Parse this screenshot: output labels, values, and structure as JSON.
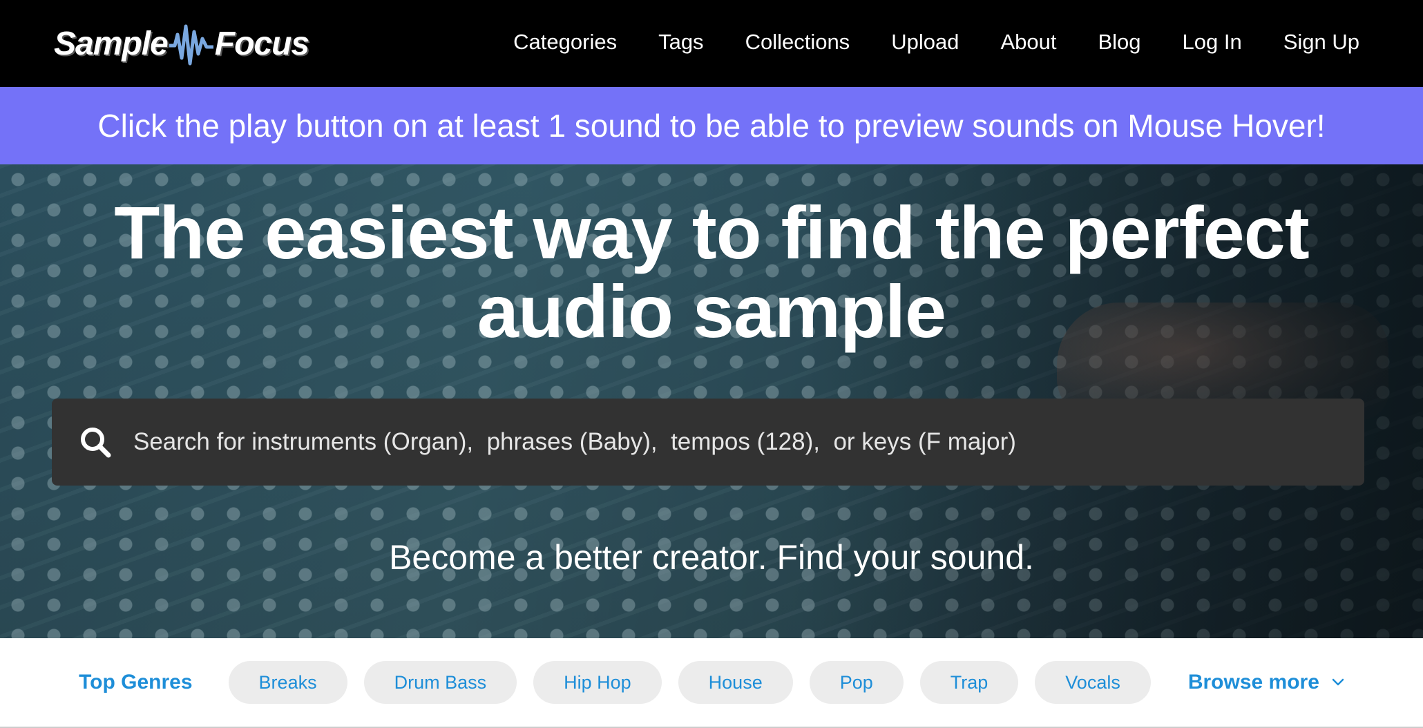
{
  "brand": {
    "logo_left": "Sample",
    "logo_right": "Focus",
    "logo_wave_color": "#7aa8e0"
  },
  "nav": {
    "items": [
      {
        "label": "Categories"
      },
      {
        "label": "Tags"
      },
      {
        "label": "Collections"
      },
      {
        "label": "Upload"
      },
      {
        "label": "About"
      },
      {
        "label": "Blog"
      },
      {
        "label": "Log In"
      },
      {
        "label": "Sign Up"
      }
    ]
  },
  "banner": {
    "text": "Click the play button on at least 1 sound to be able to preview sounds on Mouse Hover!",
    "color": "#7472f8"
  },
  "hero": {
    "headline_line1": "The easiest way to find the perfect",
    "headline_line2": "audio sample",
    "search_placeholder": "Search for instruments (Organ),  phrases (Baby),  tempos (128),  or keys (F major)",
    "search_icon": "search-icon",
    "tagline": "Become a better creator. Find your sound."
  },
  "genres": {
    "label": "Top Genres",
    "chips": [
      {
        "label": "Breaks"
      },
      {
        "label": "Drum Bass"
      },
      {
        "label": "Hip Hop"
      },
      {
        "label": "House"
      },
      {
        "label": "Pop"
      },
      {
        "label": "Trap"
      },
      {
        "label": "Vocals"
      }
    ],
    "browse_more": "Browse more",
    "browse_icon": "chevron-down-icon",
    "accent_color": "#1e8ed8"
  }
}
